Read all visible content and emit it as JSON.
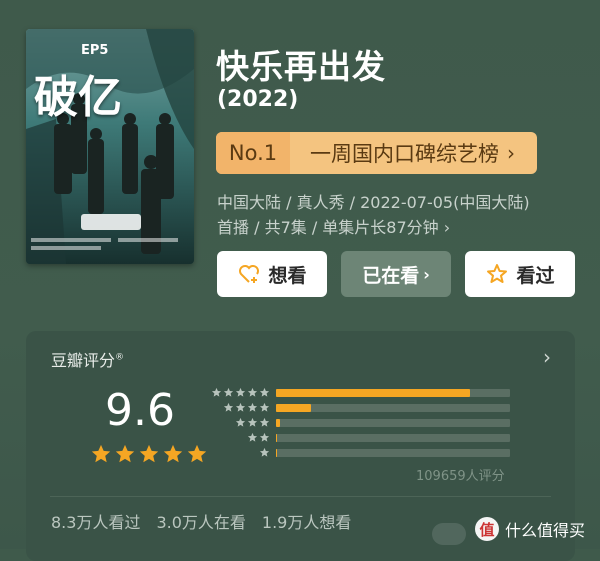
{
  "show": {
    "title": "快乐再出发",
    "year": "(2022)",
    "poster_title": "破亿",
    "poster_ep": "EP5"
  },
  "ranking": {
    "badge": "No.1",
    "label": "一周国内口碑综艺榜",
    "chevron": "›"
  },
  "meta": {
    "line1": "中国大陆 / 真人秀 / 2022-07-05(中国大陆)",
    "line2": "首播 / 共7集 / 单集片长87分钟 ›"
  },
  "actions": {
    "want": "想看",
    "watching": "已在看",
    "watched": "看过"
  },
  "rating": {
    "header": "豆瓣评分",
    "header_mark": "®",
    "score": "9.6",
    "stars": 5,
    "distribution": [
      {
        "stars": 5,
        "percent": 83.0
      },
      {
        "stars": 4,
        "percent": 14.8
      },
      {
        "stars": 3,
        "percent": 1.8
      },
      {
        "stars": 2,
        "percent": 0.3
      },
      {
        "stars": 1,
        "percent": 0.2
      }
    ],
    "count": "109659人评分",
    "seen": "8.3万人看过",
    "watching": "3.0万人在看",
    "want": "1.9万人想看"
  },
  "watermark": {
    "logo_char": "值",
    "text": "什么值得买"
  },
  "colors": {
    "accent": "#f5a623",
    "bg": "#415c4d",
    "rank_bg": "#f4c480"
  }
}
